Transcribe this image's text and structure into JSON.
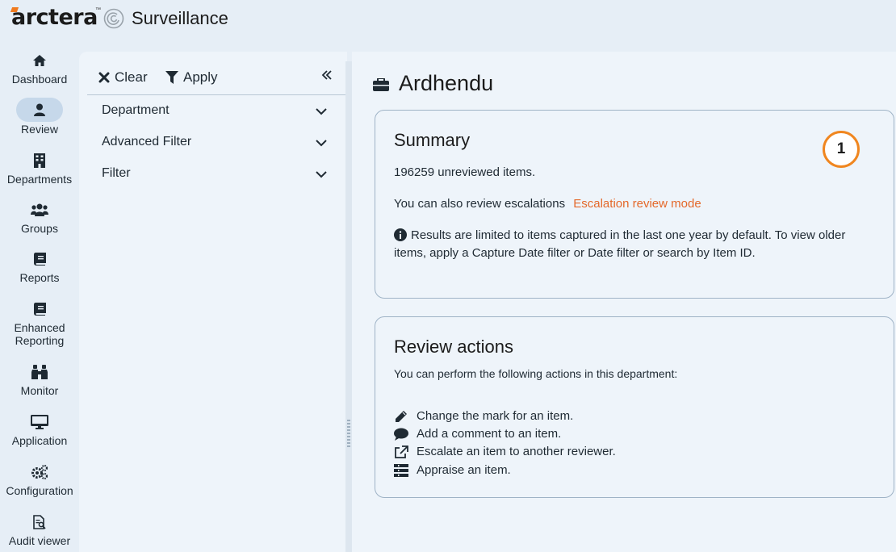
{
  "header": {
    "brand": "arctera",
    "trademark": "™",
    "app_title": "Surveillance"
  },
  "nav": {
    "items": [
      {
        "label": "Dashboard",
        "icon": "home-icon"
      },
      {
        "label": "Review",
        "icon": "user-icon"
      },
      {
        "label": "Departments",
        "icon": "building-icon"
      },
      {
        "label": "Groups",
        "icon": "users-icon"
      },
      {
        "label": "Reports",
        "icon": "book-icon"
      },
      {
        "label": "Enhanced Reporting",
        "icon": "book-icon"
      },
      {
        "label": "Monitor",
        "icon": "binoculars-icon"
      },
      {
        "label": "Application",
        "icon": "desktop-icon"
      },
      {
        "label": "Configuration",
        "icon": "gears-icon"
      },
      {
        "label": "Audit viewer",
        "icon": "file-search-icon"
      }
    ],
    "active": "Review"
  },
  "filter_panel": {
    "clear_label": "Clear",
    "apply_label": "Apply",
    "sections": [
      "Department",
      "Advanced Filter",
      "Filter"
    ]
  },
  "main": {
    "title": "Ardhendu",
    "summary": {
      "heading": "Summary",
      "unreviewed": "196259 unreviewed items.",
      "escalation_text": "You can also review escalations",
      "escalation_link": "Escalation review mode",
      "info_line1": "Results are limited to items captured in the last one year by default. To view older",
      "info_line2": "items, apply a Capture Date filter or Date filter or search by Item ID.",
      "badge": "1"
    },
    "review_actions": {
      "heading": "Review actions",
      "intro": "You can perform the following actions in this department:",
      "items": [
        {
          "label": "Change the mark for an item.",
          "icon": "pencil-icon"
        },
        {
          "label": "Add a comment to an item.",
          "icon": "comment-icon"
        },
        {
          "label": "Escalate an item to another reviewer.",
          "icon": "external-link-icon"
        },
        {
          "label": "Appraise an item.",
          "icon": "list-icon"
        }
      ]
    }
  },
  "colors": {
    "accent_orange": "#e4682a",
    "badge_ring": "#f0861f",
    "background": "#e6eef6",
    "panel": "#eef4fa"
  }
}
